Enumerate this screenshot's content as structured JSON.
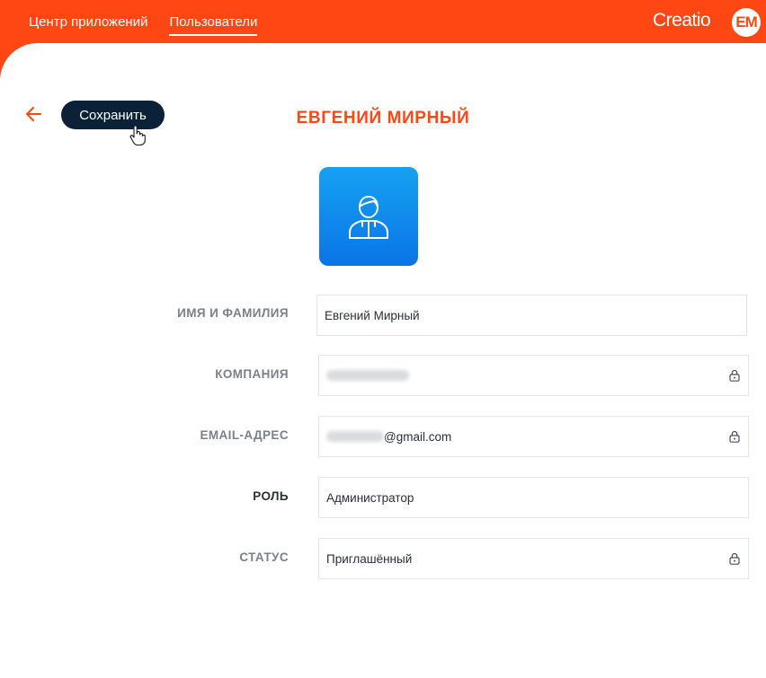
{
  "nav": {
    "items": [
      {
        "label": "Центр приложений",
        "active": false
      },
      {
        "label": "Пользователи",
        "active": true
      }
    ]
  },
  "header": {
    "logo": "Creatio",
    "avatar_initials": "EM"
  },
  "toolbar": {
    "save_label": "Сохранить"
  },
  "page": {
    "title": "ЕВГЕНИЙ МИРНЫЙ"
  },
  "photo": {
    "icon": "user-avatar-icon"
  },
  "form": {
    "full_name": {
      "label": "ИМЯ И ФАМИЛИЯ",
      "value": "Евгений Мирный",
      "locked": false
    },
    "company": {
      "label": "КОМПАНИЯ",
      "value": "",
      "locked": true,
      "redacted": true
    },
    "email": {
      "label": "EMAIL-АДРЕС",
      "value_suffix": "@gmail.com",
      "locked": true,
      "redacted_prefix": true
    },
    "role": {
      "label": "РОЛЬ",
      "value": "Администратор",
      "locked": false
    },
    "status": {
      "label": "СТАТУС",
      "value": "Приглашённый",
      "locked": true
    }
  },
  "colors": {
    "accent": "#ff4713",
    "button": "#0b2137",
    "photo_gradient_top": "#15a2f2",
    "photo_gradient_bottom": "#0a74e6"
  }
}
